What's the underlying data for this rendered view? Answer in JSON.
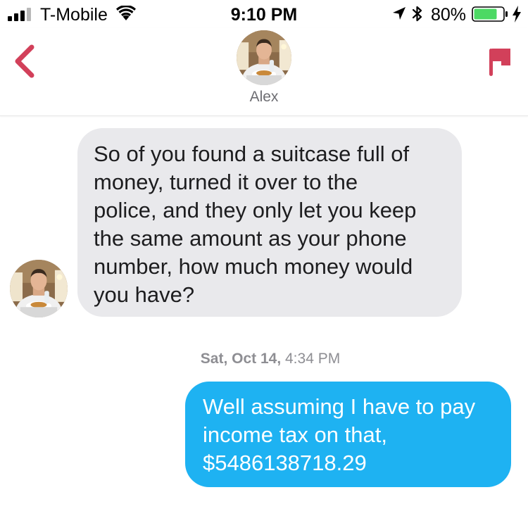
{
  "status_bar": {
    "carrier": "T-Mobile",
    "time": "9:10 PM",
    "battery_percent": "80%",
    "battery_level": 0.8,
    "battery_color": "#4cd964"
  },
  "header": {
    "contact_name": "Alex",
    "back_icon": "chevron-left-icon",
    "report_icon": "flag-icon",
    "accent_color": "#d2405a"
  },
  "messages": [
    {
      "direction": "received",
      "text": "So of you found a suitcase full of\nmoney, turned it over to the\npolice, and they only let you keep\nthe same amount as your phone\nnumber, how much money would\nyou have?"
    },
    {
      "direction": "sent",
      "text": "Well assuming I have to pay\nincome tax on that,\n$5486138718.29"
    }
  ],
  "timestamp": {
    "date": "Sat, Oct 14,",
    "time": "4:34 PM"
  },
  "colors": {
    "received_bubble": "#e9e9ec",
    "sent_bubble": "#1eb2f2"
  }
}
